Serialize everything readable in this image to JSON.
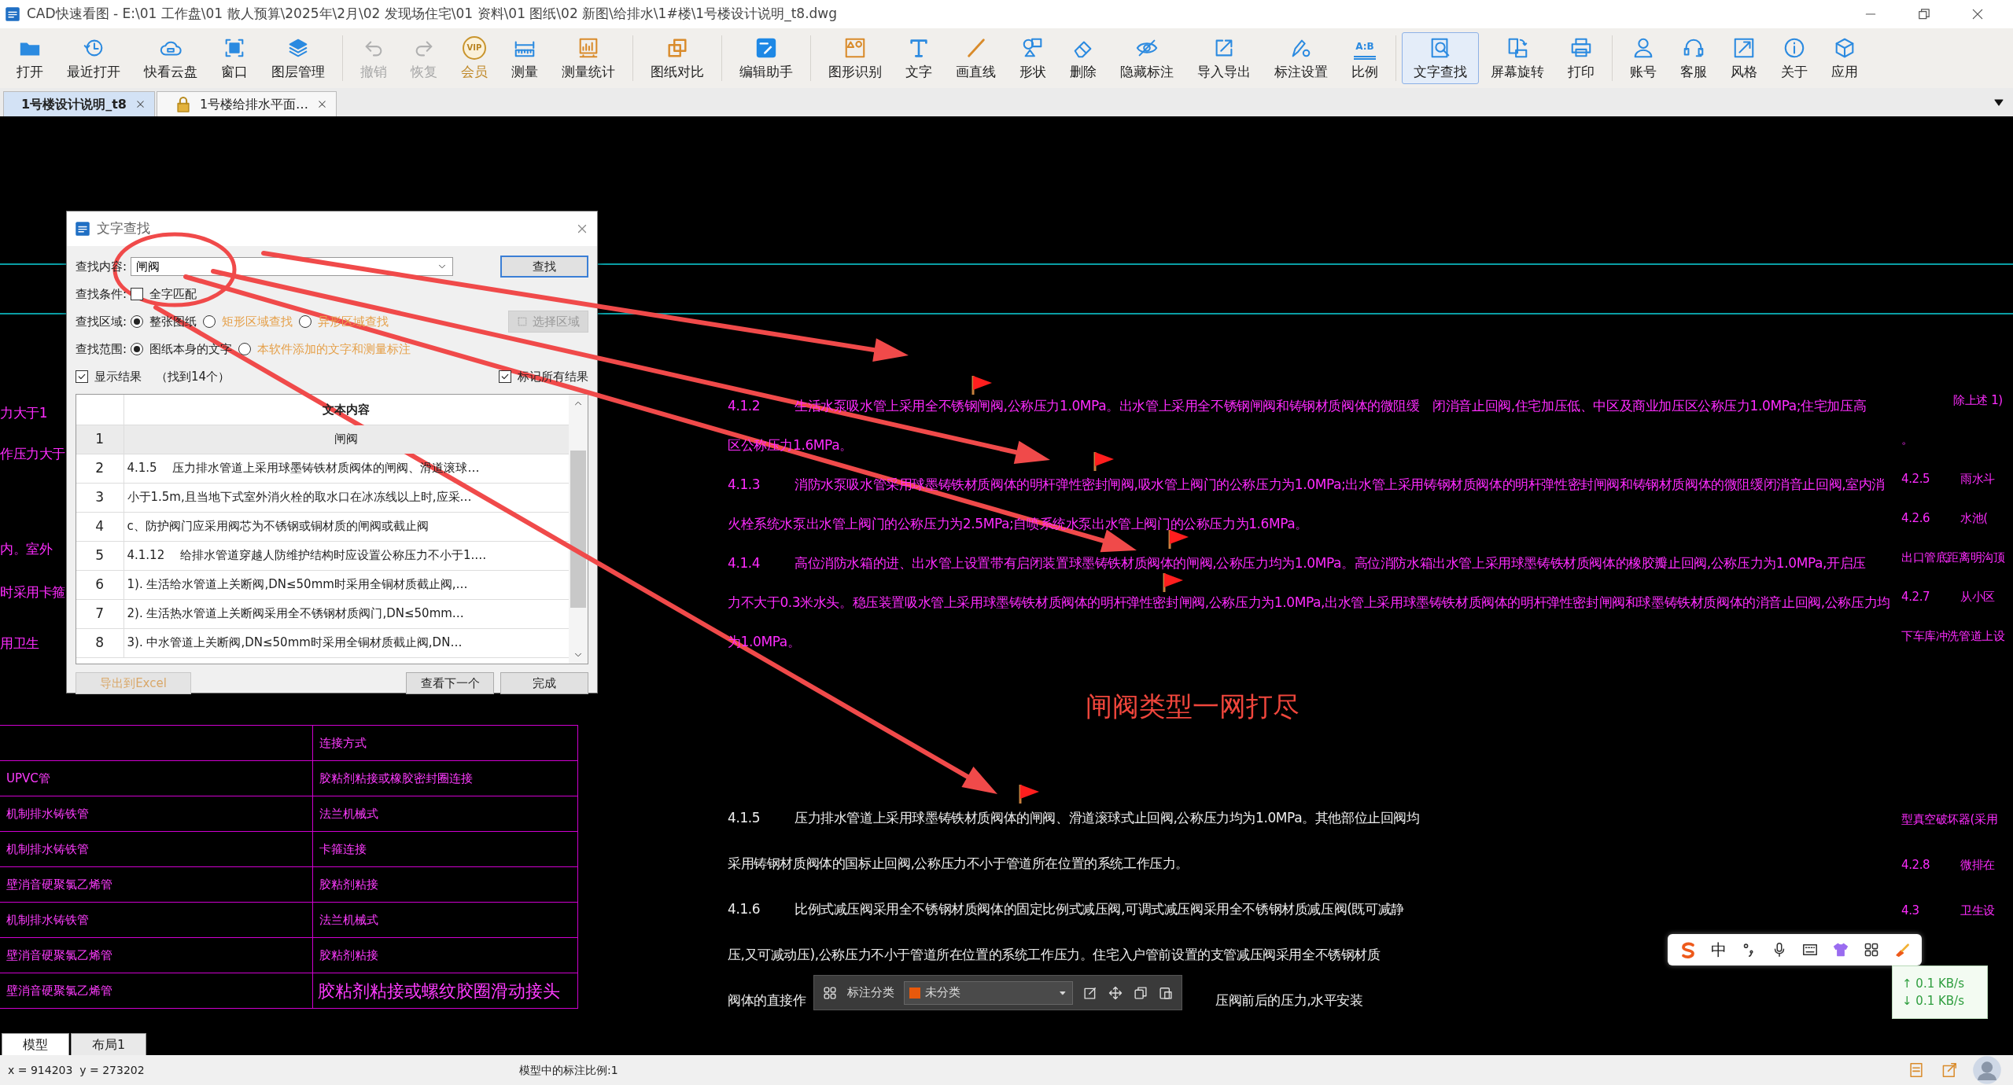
{
  "window": {
    "title": "CAD快速看图 - E:\\01 工作盘\\01 散人预算\\2025年\\2月\\02 发现场住宅\\01 资料\\01 图纸\\02 新图\\给排水\\1#楼\\1号楼设计说明_t8.dwg"
  },
  "toolbar": {
    "groups": [
      [
        {
          "label": "打开",
          "kind": "tool",
          "selected": false,
          "disabled": false
        },
        {
          "label": "最近打开",
          "kind": "tool",
          "selected": false,
          "disabled": false
        },
        {
          "label": "快看云盘",
          "kind": "tool",
          "selected": false,
          "disabled": false
        },
        {
          "label": "窗口",
          "kind": "tool",
          "selected": false,
          "disabled": false
        },
        {
          "label": "图层管理",
          "kind": "tool",
          "selected": false,
          "disabled": false
        }
      ],
      [
        {
          "label": "撤销",
          "kind": "tool",
          "selected": false,
          "disabled": true
        },
        {
          "label": "恢复",
          "kind": "tool",
          "selected": false,
          "disabled": true
        },
        {
          "label": "会员",
          "kind": "premium",
          "badge": "VIP",
          "selected": false,
          "disabled": false
        },
        {
          "label": "测量",
          "kind": "tool",
          "selected": false,
          "disabled": false
        },
        {
          "label": "测量统计",
          "kind": "tool",
          "selected": false,
          "disabled": false
        }
      ],
      [
        {
          "label": "图纸对比",
          "kind": "tool",
          "selected": false,
          "disabled": false
        }
      ],
      [
        {
          "label": "编辑助手",
          "kind": "tool",
          "selected": false,
          "disabled": false
        }
      ],
      [
        {
          "label": "图形识别",
          "kind": "tool",
          "selected": false,
          "disabled": false
        },
        {
          "label": "文字",
          "kind": "tool",
          "selected": false,
          "disabled": false
        },
        {
          "label": "画直线",
          "kind": "tool",
          "selected": false,
          "disabled": false
        },
        {
          "label": "形状",
          "kind": "tool",
          "selected": false,
          "disabled": false
        },
        {
          "label": "删除",
          "kind": "tool",
          "selected": false,
          "disabled": false
        },
        {
          "label": "隐藏标注",
          "kind": "tool",
          "selected": false,
          "disabled": false
        },
        {
          "label": "导入导出",
          "kind": "tool",
          "selected": false,
          "disabled": false
        },
        {
          "label": "标注设置",
          "kind": "tool",
          "selected": false,
          "disabled": false
        },
        {
          "label": "比例",
          "kind": "tool",
          "badge": "A:B",
          "selected": false,
          "disabled": false
        }
      ],
      [
        {
          "label": "文字查找",
          "kind": "tool",
          "selected": true,
          "disabled": false
        },
        {
          "label": "屏幕旋转",
          "kind": "tool",
          "selected": false,
          "disabled": false
        },
        {
          "label": "打印",
          "kind": "tool",
          "selected": false,
          "disabled": false
        }
      ],
      [
        {
          "label": "账号",
          "kind": "tool",
          "selected": false,
          "disabled": false
        },
        {
          "label": "客服",
          "kind": "tool",
          "selected": false,
          "disabled": false
        },
        {
          "label": "风格",
          "kind": "tool",
          "selected": false,
          "disabled": false
        },
        {
          "label": "关于",
          "kind": "tool",
          "selected": false,
          "disabled": false
        },
        {
          "label": "应用",
          "kind": "tool",
          "selected": false,
          "disabled": false
        }
      ]
    ]
  },
  "file_tabs": [
    {
      "label": "1号楼设计说明_t8",
      "selected": true,
      "locked": false
    },
    {
      "label": "1号楼给排水平面…",
      "selected": false,
      "locked": true
    }
  ],
  "canvas": {
    "left_fragments": [
      "力大于1",
      "作压力大于",
      "内。室外",
      "时采用卡箍",
      "用卫生"
    ],
    "notes_upper": [
      {
        "number": "4.1.2",
        "lines": [
          "生活水泵吸水管上采用全不锈钢闸阀,公称压力1.0MPa。出水管上采用全不锈钢闸阀和铸钢材质阀体的微阻缓　闭消音止回阀,住宅加压低、中区及商业加压区公称压力1.0MPa;住宅加压高",
          "区公称压力1.6MPa。"
        ]
      },
      {
        "number": "4.1.3",
        "lines": [
          "消防水泵吸水管采用球墨铸铁材质阀体的明杆弹性密封闸阀,吸水管上阀门的公称压力为1.0MPa;出水管上采用铸钢材质阀体的明杆弹性密封闸阀和铸钢材质阀体的微阻缓闭消音止回阀,室内消",
          "火栓系统水泵出水管上阀门的公称压力为2.5MPa;自喷系统水泵出水管上阀门的公称压力为1.6MPa。"
        ]
      },
      {
        "number": "4.1.4",
        "lines": [
          "高位消防水箱的进、出水管上设置带有启闭装置球墨铸铁材质阀体的闸阀,公称压力均为1.0MPa。高位消防水箱出水管上采用球墨铸铁材质阀体的橡胶瓣止回阀,公称压力为1.0MPa,开启压",
          "力不大于0.3米水头。稳压装置吸水管上采用球墨铸铁材质阀体的明杆弹性密封闸阀,公称压力为1.0MPa,出水管上采用球墨铸铁材质阀体的明杆弹性密封闸阀和球墨铸铁材质阀体的消音止回阀,公称压力均",
          "为1.0MPa。"
        ]
      }
    ],
    "right_upper": [
      {
        "kind": "indented",
        "text": "除上述 1)"
      },
      {
        "kind": "plain",
        "text": "。"
      },
      {
        "kind": "numbered",
        "number": "4.2.5",
        "text": "雨水斗"
      },
      {
        "kind": "numbered",
        "number": "4.2.6",
        "text": "水池("
      },
      {
        "kind": "plain",
        "text": "出口管底距离明沟顶"
      },
      {
        "kind": "numbered",
        "number": "4.2.7",
        "text": "从小区"
      },
      {
        "kind": "plain",
        "text": "下车库冲洗管道上设"
      }
    ],
    "caption": "闸阀类型一网打尽",
    "notes_lower": [
      {
        "number": "4.1.5",
        "lines": [
          "压力排水管道上采用球墨铸铁材质阀体的闸阀、滑道滚球式止回阀,公称压力均为1.0MPa。其他部位止回阀均",
          "采用铸钢材质阀体的国标止回阀,公称压力不小于管道所在位置的系统工作压力。"
        ]
      },
      {
        "number": "4.1.6",
        "lines": [
          "比例式减压阀采用全不锈钢材质阀体的固定比例式减压阀,可调式减压阀采用全不锈钢材质减压阀(既可减静",
          "压,又可减动压),公称压力不小于管道所在位置的系统工作压力。住宅入户管前设置的支管减压阀采用全不锈钢材质",
          "阀体的直接作"
        ]
      }
    ],
    "covered_tail": "压阀前后的压力,水平安装",
    "right_lower": [
      {
        "kind": "plain",
        "text": "型真空破坏器(采用"
      },
      {
        "kind": "numbered",
        "number": "4.2.8",
        "text": "微排在"
      },
      {
        "kind": "numbered",
        "number": "4.3",
        "text": "卫生设"
      }
    ],
    "pipe_table": {
      "header": "连接方式",
      "rows": [
        {
          "material": "UPVC管",
          "joint": "胶粘剂粘接或橡胶密封圈连接",
          "kind": "normal"
        },
        {
          "material": "机制排水铸铁管",
          "joint": "法兰机械式",
          "kind": "normal"
        },
        {
          "material": "机制排水铸铁管",
          "joint": "卡箍连接",
          "kind": "normal"
        },
        {
          "material": "壁消音硬聚氯乙烯管",
          "joint": "胶粘剂粘接",
          "kind": "normal"
        },
        {
          "material": "机制排水铸铁管",
          "joint": "法兰机械式",
          "kind": "normal"
        },
        {
          "material": "壁消音硬聚氯乙烯管",
          "joint": "胶粘剂粘接",
          "kind": "normal"
        },
        {
          "material": "壁消音硬聚氯乙烯管",
          "joint": "胶粘剂粘接或螺纹胶圈滑动接头",
          "kind": "large"
        }
      ]
    }
  },
  "find_dialog": {
    "title": "文字查找",
    "search": {
      "label": "查找内容:",
      "value": "闸阀",
      "button": "查找"
    },
    "condition": {
      "label": "查找条件:",
      "option": "全字匹配",
      "checked": false
    },
    "area": {
      "label": "查找区域:",
      "options": [
        {
          "label": "整张图纸",
          "selected": true
        },
        {
          "label": "矩形区域查找",
          "selected": false
        },
        {
          "label": "异形区域查找",
          "selected": false
        }
      ],
      "button": "选择区域",
      "button_disabled": true
    },
    "scope": {
      "label": "查找范围:",
      "options": [
        {
          "label": "图纸本身的文字",
          "selected": true
        },
        {
          "label": "本软件添加的文字和测量标注",
          "selected": false
        }
      ]
    },
    "show_results": {
      "label": "显示结果",
      "checked": true,
      "count": "（找到14个）"
    },
    "mark_all": {
      "label": "标记所有结果",
      "checked": true
    },
    "results": {
      "column": "文本内容",
      "rows": [
        {
          "number": "1",
          "text": "闸阀",
          "selected": true
        },
        {
          "number": "2",
          "text": "4.1.5　 压力排水管道上采用球墨铸铁材质阀体的闸阀、滑道滚球…",
          "selected": false
        },
        {
          "number": "3",
          "text": "小于1.5m,且当地下式室外消火栓的取水口在冰冻线以上时,应采…",
          "selected": false
        },
        {
          "number": "4",
          "text": "c、防护阀门应采用阀芯为不锈钢或铜材质的闸阀或截止阀",
          "selected": false
        },
        {
          "number": "5",
          "text": "4.1.12　 给排水管道穿越人防维护结构时应设置公称压力不小于1.…",
          "selected": false
        },
        {
          "number": "6",
          "text": "1). 生活给水管道上关断阀,DN≤50mm时采用全铜材质截止阀,…",
          "selected": false
        },
        {
          "number": "7",
          "text": "2). 生活热水管道上关断阀采用全不锈钢材质阀门,DN≤50mm…",
          "selected": false
        },
        {
          "number": "8",
          "text": "3). 中水管道上关断阀,DN≤50mm时采用全铜材质截止阀,DN…",
          "selected": false
        }
      ]
    },
    "buttons": [
      {
        "label": "导出到Excel",
        "disabled": true
      },
      {
        "label": "查看下一个",
        "disabled": false
      },
      {
        "label": "完成",
        "disabled": false
      }
    ]
  },
  "annotation_bar": {
    "label": "标注分类",
    "category": "未分类",
    "color": "#e8590c"
  },
  "ime_bar": {
    "mode": "中"
  },
  "net_speed": {
    "upload": "↑ 0.1 KB/s",
    "download": "↓ 0.1 KB/s"
  },
  "layout_tabs": [
    {
      "label": "模型",
      "selected": true
    },
    {
      "label": "布局1",
      "selected": false
    }
  ],
  "status_bar": {
    "coordinates": "x = 914203  y = 273202",
    "scale": "模型中的标注比例:1"
  }
}
